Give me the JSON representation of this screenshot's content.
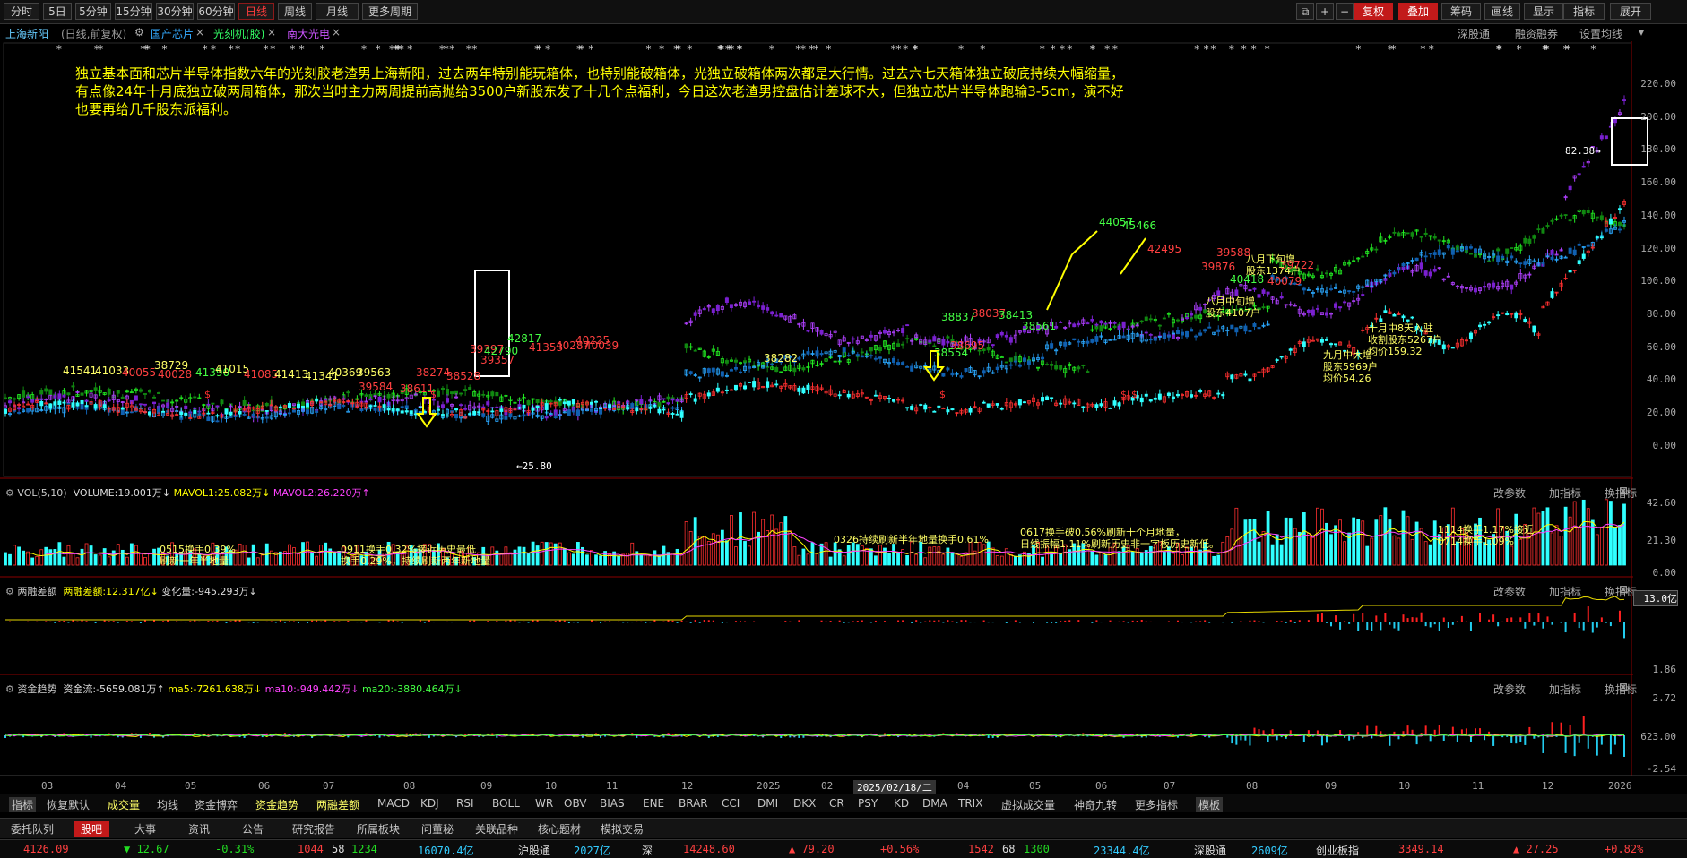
{
  "toolbar": {
    "period_buttons": [
      "分时",
      "5日",
      "5分钟",
      "15分钟",
      "30分钟",
      "60分钟",
      "日线",
      "周线",
      "月线",
      "更多周期"
    ],
    "right_buttons": [
      "复权",
      "叠加",
      "筹码",
      "画线",
      "显示",
      "指标",
      "展开"
    ]
  },
  "title_row": {
    "stock": "上海新阳",
    "mode": "(日线,前复权)",
    "overlays": [
      "国产芯片",
      "光刻机(胶)",
      "南大光电"
    ],
    "right_links": [
      "深股通",
      "融资融券",
      "设置均线"
    ]
  },
  "colors": {
    "up": "#ff3030",
    "down": "#30ffff",
    "green": "#22e022",
    "purple": "#b040ff",
    "blue": "#2aa8ff",
    "yellow": "#ffff00",
    "accent": "#ff6600"
  },
  "comment": "独立基本面和芯片半导体指数六年的光刻胶老渣男上海新阳，过去两年特别能玩箱体，也特别能破箱体，光独立破箱体两次都是大行情。过去六七天箱体独立破底持续大幅缩量，有点像24年十月底独立破两周箱体，那次当时主力两周提前高抛给3500户新股东发了十几个点福利，今日这次老渣男控盘估计差球不大，但独立芯片半导体跑输3-5cm，演不好也要再给几千股东派福利。",
  "price_axis": [
    "220.00",
    "200.00",
    "180.00",
    "160.00",
    "140.00",
    "120.00",
    "100.00",
    "80.00",
    "60.00",
    "40.00",
    "20.00",
    "0.00"
  ],
  "price_markers": {
    "high_left": "82.38",
    "low": "25.80"
  },
  "main_annotations": [
    {
      "text": "八月下旬增\n股东1374户",
      "color": "#ffff66"
    },
    {
      "text": "八月中旬增\n股东4107户",
      "color": "#ffff66"
    },
    {
      "text": "九月中大增\n股东5969户\n均价54.26",
      "color": "#ffff66"
    },
    {
      "text": "十月中8天入驻\n收割股东5267户\n均价159.32",
      "color": "#ffff66"
    }
  ],
  "chip_labels": [
    {
      "t": "41541",
      "c": "#ffff66"
    },
    {
      "t": "41033",
      "c": "#ffff66"
    },
    {
      "t": "40055",
      "c": "#ff4040"
    },
    {
      "t": "38729",
      "c": "#ffff66"
    },
    {
      "t": "40028",
      "c": "#ff4040"
    },
    {
      "t": "41390",
      "c": "#44ff44"
    },
    {
      "t": "41015",
      "c": "#ffff66"
    },
    {
      "t": "41085",
      "c": "#ff4040"
    },
    {
      "t": "41413",
      "c": "#ffff66"
    },
    {
      "t": "41341",
      "c": "#ffff66"
    },
    {
      "t": "40369",
      "c": "#ffff66"
    },
    {
      "t": "39563",
      "c": "#ffff66"
    },
    {
      "t": "39584",
      "c": "#ff4040"
    },
    {
      "t": "38611",
      "c": "#ff4040"
    },
    {
      "t": "38274",
      "c": "#ff4040"
    },
    {
      "t": "38528",
      "c": "#ff4040"
    },
    {
      "t": "39397",
      "c": "#ff4040"
    },
    {
      "t": "42790",
      "c": "#44ff44"
    },
    {
      "t": "39357",
      "c": "#ff4040"
    },
    {
      "t": "42817",
      "c": "#44ff44"
    },
    {
      "t": "41353",
      "c": "#ff4040"
    },
    {
      "t": "40287",
      "c": "#ff4040"
    },
    {
      "t": "40225",
      "c": "#ff4040"
    },
    {
      "t": "40039",
      "c": "#ff4040"
    },
    {
      "t": "38282",
      "c": "#ffff66"
    },
    {
      "t": "38837",
      "c": "#44ff44"
    },
    {
      "t": "38037",
      "c": "#ff4040"
    },
    {
      "t": "38413",
      "c": "#44ff44"
    },
    {
      "t": "38561",
      "c": "#44ff44"
    },
    {
      "t": "38695",
      "c": "#ff4040"
    },
    {
      "t": "38554",
      "c": "#44ff44"
    },
    {
      "t": "40418",
      "c": "#44ff44"
    },
    {
      "t": "40079",
      "c": "#ff4040"
    },
    {
      "t": "39722",
      "c": "#ff4040"
    },
    {
      "t": "44057",
      "c": "#44ff44"
    },
    {
      "t": "45466",
      "c": "#44ff44"
    },
    {
      "t": "39876",
      "c": "#ff4040"
    },
    {
      "t": "39588",
      "c": "#ff4040"
    },
    {
      "t": "42495",
      "c": "#ff4040"
    }
  ],
  "vol_panel": {
    "title": "VOL(5,10)",
    "volume": "VOLUME:19.001万",
    "mavol1": "MAVOL1:25.082万",
    "mavol2": "MAVOL2:26.220万",
    "axis": [
      "42.60",
      "21.30",
      "0.00"
    ],
    "notes": [
      "0515换手0.39%\n刷新一年半地量",
      "0911换手0.32%接近历史最低\n换手0.29%，持续刷新两年新地量",
      "0326持续刷新半年地量换手0.61%",
      "0617换手破0.56%刷新十个月地量，\n日线振幅1.11%刷新历史非一字板历史新低。",
      "1114换手1.17%接近\n0714换手1.09%"
    ]
  },
  "margin_panel": {
    "title": "两融差额",
    "value": "两融差额:12.317亿",
    "change": "变化量:-945.293万",
    "axis": [
      "13.0亿",
      "1.86"
    ]
  },
  "flow_panel": {
    "title": "资金趋势",
    "flow": "资金流:-5659.081万",
    "ma5": "ma5:-7261.638万",
    "ma10": "ma10:-949.442万",
    "ma20": "ma20:-3880.464万",
    "axis": [
      "2.72",
      "623.00",
      "-2.54"
    ]
  },
  "panel_buttons": [
    "改参数",
    "加指标",
    "换指标"
  ],
  "x_axis": [
    "03",
    "04",
    "05",
    "06",
    "07",
    "08",
    "09",
    "10",
    "11",
    "12",
    "2025",
    "02",
    "2025/02/18/二",
    "04",
    "05",
    "06",
    "07",
    "08",
    "09",
    "10",
    "11",
    "12",
    "2026"
  ],
  "indicator_tabs": [
    "指标",
    "恢复默认",
    "成交量",
    "均线",
    "资金博弈",
    "资金趋势",
    "两融差额",
    "MACD",
    "KDJ",
    "RSI",
    "BOLL",
    "WR",
    "OBV",
    "BIAS",
    "ENE",
    "BRAR",
    "CCI",
    "DMI",
    "DKX",
    "CR",
    "PSY",
    "KD",
    "DMA",
    "TRIX",
    "虚拟成交量",
    "神奇九转",
    "更多指标",
    "模板"
  ],
  "bottom_tabs": [
    "委托队列",
    "股吧",
    "大事",
    "资讯",
    "公告",
    "研究报告",
    "所属板块",
    "问董秘",
    "关联品种",
    "核心题材",
    "模拟交易"
  ],
  "status": {
    "sh_index": "4126.09",
    "sh_change": "▼ 12.67",
    "sh_pct": "-0.31%",
    "sh_up": "1044",
    "sh_flat": "58",
    "sh_down": "1234",
    "sh_amount": "16070.4亿",
    "hgt_label": "沪股通",
    "hgt_value": "2027亿",
    "sz_label": "深",
    "sz_index": "14248.60",
    "sz_change": "▲ 79.20",
    "sz_pct": "+0.56%",
    "sz_up": "1542",
    "sz_flat": "68",
    "sz_down": "1300",
    "sz_amount": "23344.4亿",
    "sgt_label": "深股通",
    "sgt_value": "2609亿",
    "cyb_label": "创业板指",
    "cyb_index": "3349.14",
    "cyb_change": "▲ 27.25",
    "cyb_pct": "+0.82%"
  }
}
